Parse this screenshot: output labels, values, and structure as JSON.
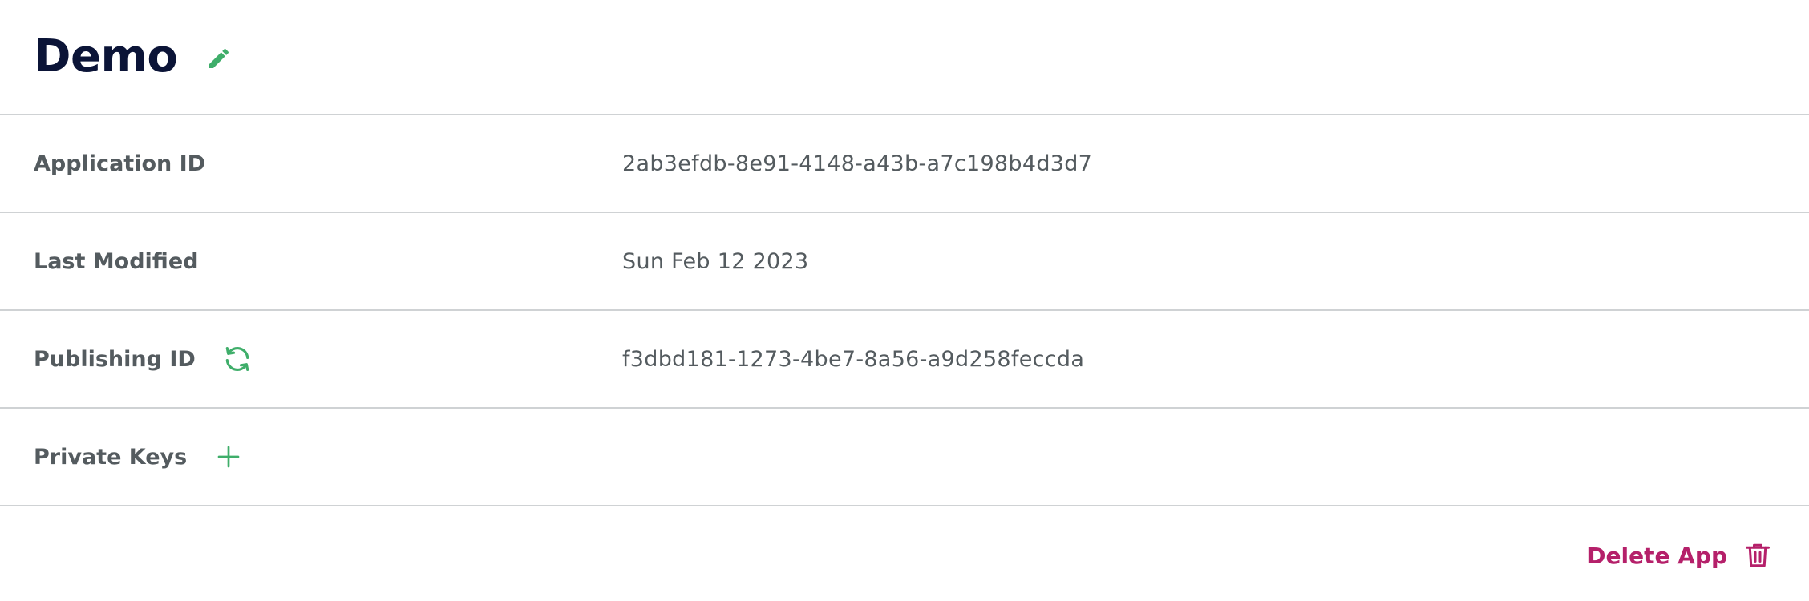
{
  "app": {
    "title": "Demo"
  },
  "details": {
    "application_id": {
      "label": "Application ID",
      "value": "2ab3efdb-8e91-4148-a43b-a7c198b4d3d7"
    },
    "last_modified": {
      "label": "Last Modified",
      "value": "Sun Feb 12 2023"
    },
    "publishing_id": {
      "label": "Publishing ID",
      "value": "f3dbd181-1273-4be7-8a56-a9d258feccda"
    },
    "private_keys": {
      "label": "Private Keys"
    }
  },
  "actions": {
    "delete_label": "Delete App"
  },
  "icons": {
    "edit": "pencil-icon",
    "refresh": "refresh-icon",
    "add": "plus-icon",
    "delete": "trash-icon"
  },
  "colors": {
    "title": "#0b1437",
    "text": "#545b5f",
    "accent_green": "#3fae6a",
    "danger": "#b5206a",
    "divider": "#cfd2d4"
  }
}
